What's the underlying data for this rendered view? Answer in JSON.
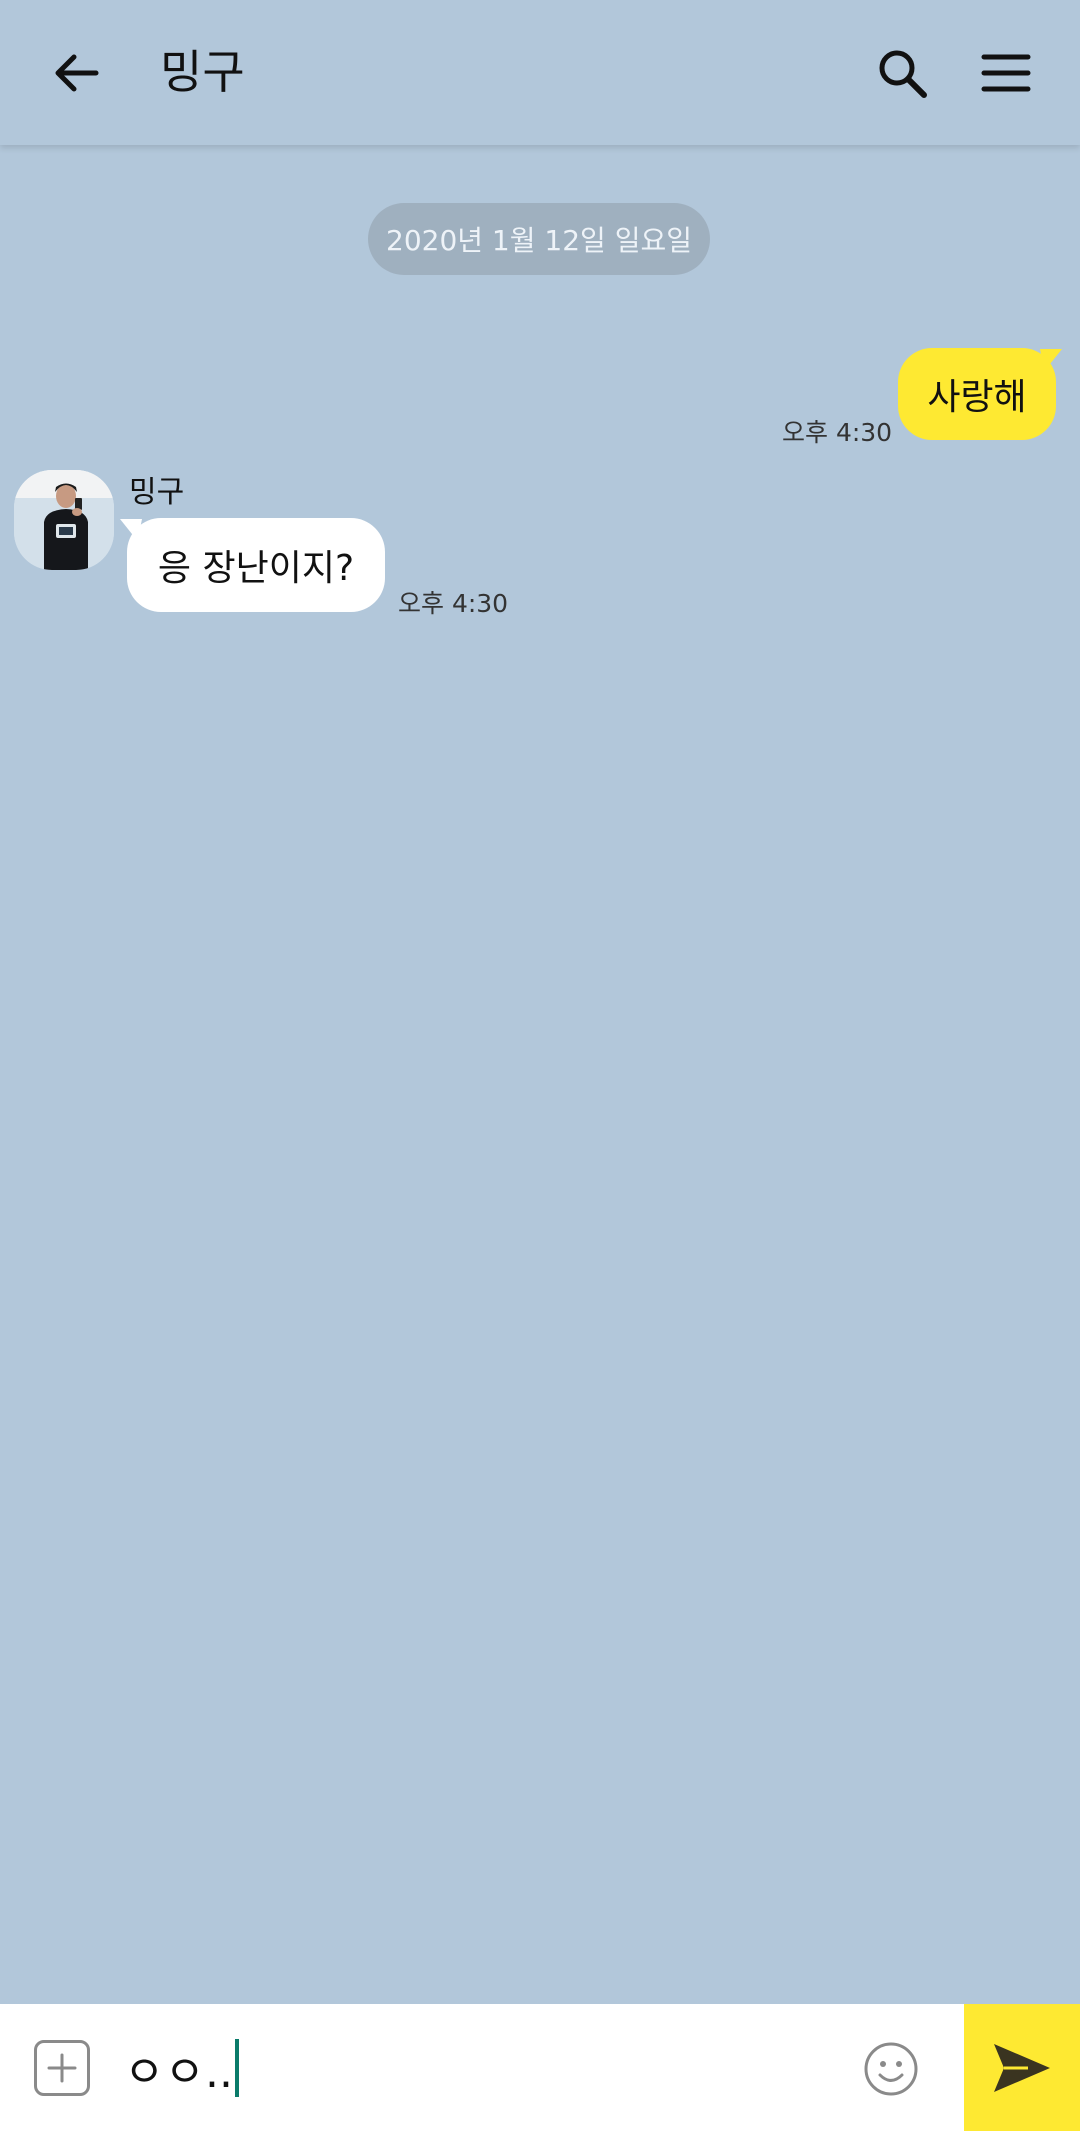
{
  "header": {
    "title": "밍구",
    "back_icon": "arrow-left-icon",
    "search_icon": "search-icon",
    "menu_icon": "hamburger-menu-icon"
  },
  "chat": {
    "date_divider": "2020년 1월 12일 일요일",
    "messages": [
      {
        "direction": "sent",
        "text": "사랑해",
        "time": "오후 4:30"
      },
      {
        "direction": "received",
        "sender": "밍구",
        "text": "응 장난이지?",
        "time": "오후 4:30"
      }
    ]
  },
  "composer": {
    "value": "ㅇㅇ..",
    "attach_icon": "plus-square-icon",
    "emoji_icon": "smiley-icon",
    "send_icon": "send-arrow-icon"
  },
  "colors": {
    "background": "#b2c7da",
    "sent_bubble": "#fee932",
    "received_bubble": "#ffffff",
    "send_button": "#fee932",
    "date_pill": "#9fb0bf"
  }
}
